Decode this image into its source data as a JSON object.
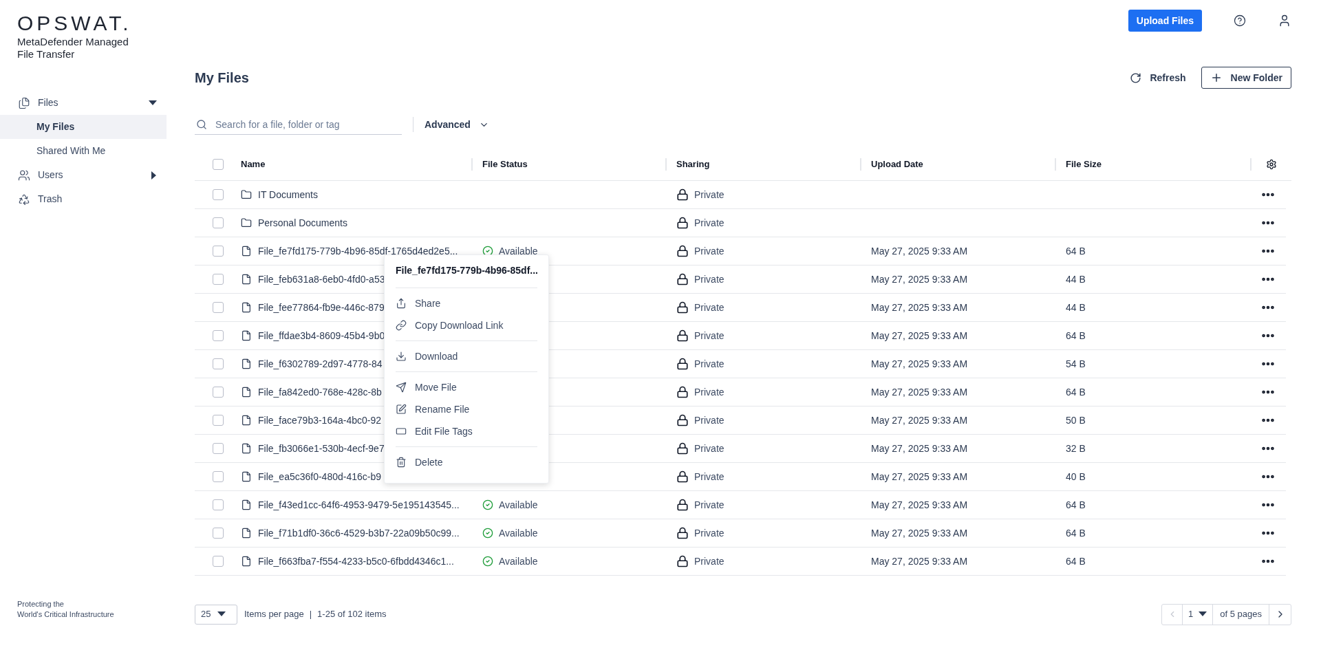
{
  "brand": {
    "logo": "OPSWAT.",
    "product": "MetaDefender Managed File Transfer",
    "tagline_lines": [
      "Protecting the",
      "World's Critical Infrastructure"
    ]
  },
  "header": {
    "upload_button": "Upload Files"
  },
  "sidebar": {
    "items": [
      {
        "label": "Files",
        "kind": "files",
        "expanded": true,
        "children": [
          {
            "label": "My Files",
            "selected": true
          },
          {
            "label": "Shared With Me",
            "selected": false
          }
        ]
      },
      {
        "label": "Users",
        "kind": "users",
        "expanded": false
      },
      {
        "label": "Trash",
        "kind": "trash"
      }
    ]
  },
  "page": {
    "title": "My Files",
    "refresh": "Refresh",
    "new_folder": "New Folder"
  },
  "search": {
    "placeholder": "Search for a file, folder or tag",
    "advanced": "Advanced"
  },
  "table": {
    "select_all_checked": false,
    "columns": [
      "Name",
      "File Status",
      "Sharing",
      "Upload Date",
      "File Size"
    ],
    "rows": [
      {
        "kind": "folder",
        "checked": false,
        "name": "IT Documents",
        "sharing": "Private"
      },
      {
        "kind": "folder",
        "checked": false,
        "name": "Personal Documents",
        "sharing": "Private"
      },
      {
        "kind": "file",
        "checked": false,
        "name": "File_fe7fd175-779b-4b96-85df-1765d4ed2e5...",
        "status": "Available",
        "sharing": "Private",
        "date": "May 27, 2025 9:33 AM",
        "size": "64 B"
      },
      {
        "kind": "file",
        "checked": false,
        "name": "File_feb631a8-6eb0-4fd0-a53",
        "sharing": "Private",
        "date": "May 27, 2025 9:33 AM",
        "size": "44 B"
      },
      {
        "kind": "file",
        "checked": false,
        "name": "File_fee77864-fb9e-446c-879",
        "sharing": "Private",
        "date": "May 27, 2025 9:33 AM",
        "size": "44 B"
      },
      {
        "kind": "file",
        "checked": false,
        "name": "File_ffdae3b4-8609-45b4-9b0",
        "sharing": "Private",
        "date": "May 27, 2025 9:33 AM",
        "size": "64 B"
      },
      {
        "kind": "file",
        "checked": false,
        "name": "File_f6302789-2d97-4778-84",
        "sharing": "Private",
        "date": "May 27, 2025 9:33 AM",
        "size": "54 B"
      },
      {
        "kind": "file",
        "checked": false,
        "name": "File_fa842ed0-768e-428c-8b",
        "sharing": "Private",
        "date": "May 27, 2025 9:33 AM",
        "size": "64 B"
      },
      {
        "kind": "file",
        "checked": false,
        "name": "File_face79b3-164a-4bc0-92",
        "sharing": "Private",
        "date": "May 27, 2025 9:33 AM",
        "size": "50 B"
      },
      {
        "kind": "file",
        "checked": false,
        "name": "File_fb3066e1-530b-4ecf-9e7",
        "sharing": "Private",
        "date": "May 27, 2025 9:33 AM",
        "size": "32 B"
      },
      {
        "kind": "file",
        "checked": false,
        "name": "File_ea5c36f0-480d-416c-b9",
        "sharing": "Private",
        "date": "May 27, 2025 9:33 AM",
        "size": "40 B"
      },
      {
        "kind": "file",
        "checked": false,
        "name": "File_f43ed1cc-64f6-4953-9479-5e195143545...",
        "status": "Available",
        "sharing": "Private",
        "date": "May 27, 2025 9:33 AM",
        "size": "64 B"
      },
      {
        "kind": "file",
        "checked": false,
        "name": "File_f71b1df0-36c6-4529-b3b7-22a09b50c99...",
        "status": "Available",
        "sharing": "Private",
        "date": "May 27, 2025 9:33 AM",
        "size": "64 B"
      },
      {
        "kind": "file",
        "checked": false,
        "name": "File_f663fba7-f554-4233-b5c0-6fbdd4346c1...",
        "status": "Available",
        "sharing": "Private",
        "date": "May 27, 2025 9:33 AM",
        "size": "64 B"
      }
    ]
  },
  "context_menu": {
    "title": "File_fe7fd175-779b-4b96-85df...",
    "groups": [
      [
        {
          "kind": "share",
          "label": "Share"
        },
        {
          "kind": "link",
          "label": "Copy Download Link"
        }
      ],
      [
        {
          "kind": "download",
          "label": "Download"
        }
      ],
      [
        {
          "kind": "move",
          "label": "Move File"
        },
        {
          "kind": "rename",
          "label": "Rename File"
        },
        {
          "kind": "tags",
          "label": "Edit File Tags"
        }
      ],
      [
        {
          "kind": "delete",
          "label": "Delete"
        }
      ]
    ]
  },
  "pagination": {
    "page_size": "25",
    "items_per_page": "Items per page",
    "separator": "|",
    "range": "1-25 of 102 items",
    "page": "1",
    "of_pages": "of 5 pages",
    "prev_disabled": true,
    "next_disabled": false
  }
}
